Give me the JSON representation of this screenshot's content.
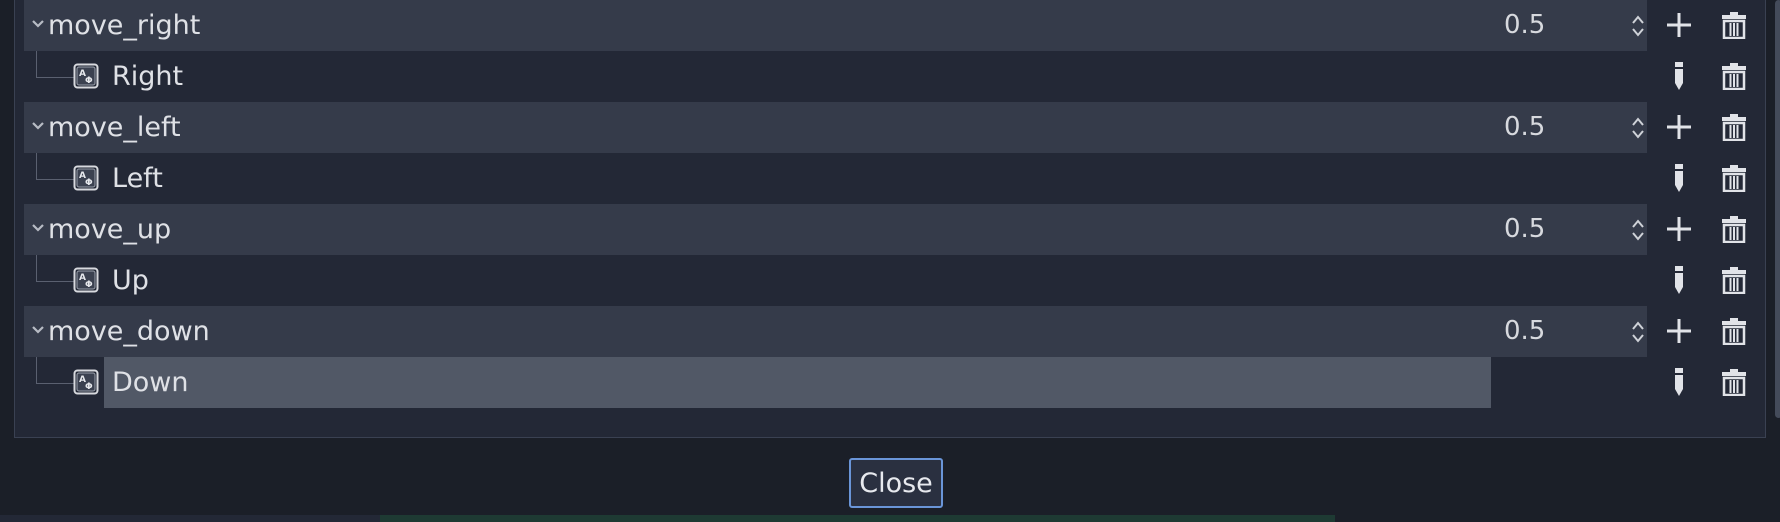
{
  "actions": [
    {
      "name": "move_right",
      "deadzone": "0.5",
      "events": [
        {
          "label": "Right",
          "selected": false
        }
      ]
    },
    {
      "name": "move_left",
      "deadzone": "0.5",
      "events": [
        {
          "label": "Left",
          "selected": false
        }
      ]
    },
    {
      "name": "move_up",
      "deadzone": "0.5",
      "events": [
        {
          "label": "Up",
          "selected": false
        }
      ]
    },
    {
      "name": "move_down",
      "deadzone": "0.5",
      "events": [
        {
          "label": "Down",
          "selected": true
        }
      ]
    }
  ],
  "footer": {
    "close_label": "Close"
  },
  "icons": {
    "expand": "chevron-down-icon",
    "spin": "spin-arrows-icon",
    "add": "plus-icon",
    "delete": "trash-icon",
    "edit": "pencil-icon",
    "key_event": "keyboard-key-icon"
  },
  "colors": {
    "accent": "#6a95d8",
    "action_row": "#353b4a",
    "selection": "#515866"
  }
}
